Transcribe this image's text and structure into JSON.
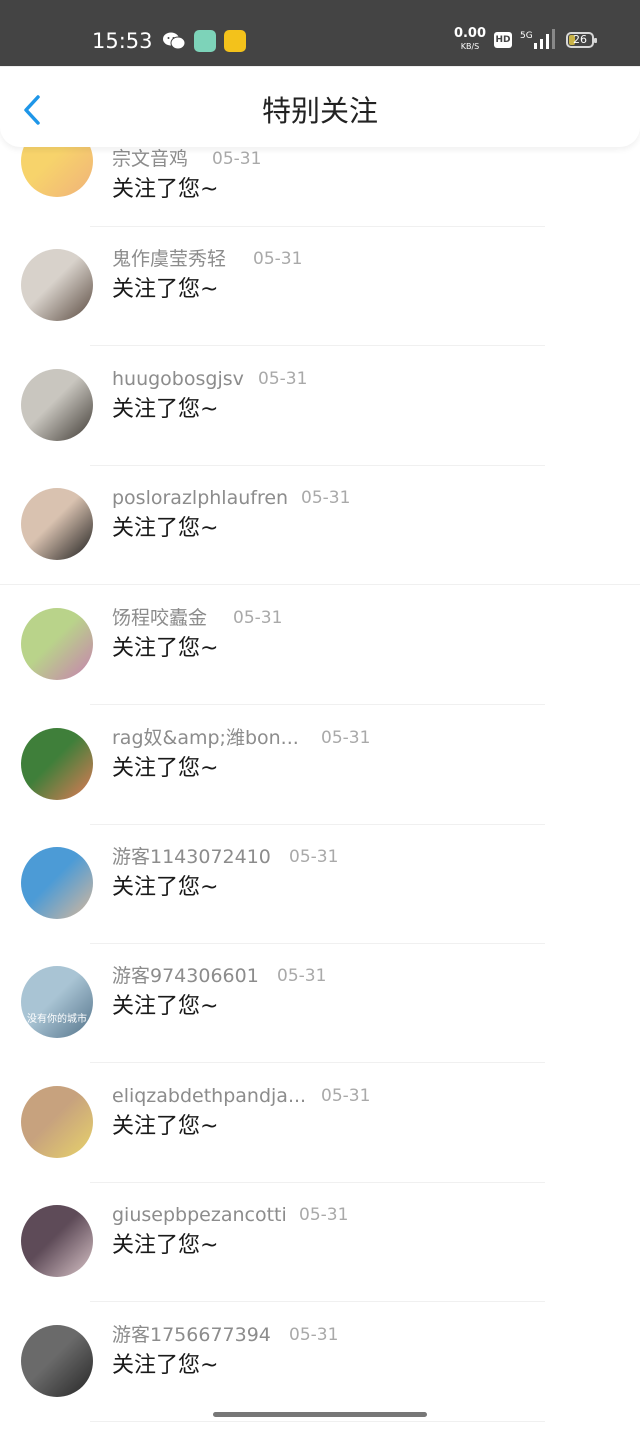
{
  "status_bar": {
    "time": "15:53",
    "net_speed": "0.00",
    "net_unit": "KB/S",
    "hd": "HD",
    "signal": "5G",
    "battery": "26"
  },
  "header": {
    "title": "特别关注",
    "back_icon": "chevron-left-icon"
  },
  "items": [
    {
      "name": "宗文音鸡",
      "date": "05-31",
      "message": "关注了您~",
      "avatar_colors": [
        "#f7d36b",
        "#f0b27a"
      ]
    },
    {
      "name": "鬼作虞莹秀轻",
      "date": "05-31",
      "message": "关注了您~",
      "avatar_colors": [
        "#d8d2cb",
        "#5a4a40"
      ]
    },
    {
      "name": "huugobosgjsv",
      "date": "05-31",
      "message": "关注了您~",
      "avatar_colors": [
        "#c9c6bf",
        "#3f3a34"
      ]
    },
    {
      "name": "poslorazlphlaufren",
      "date": "05-31",
      "message": "关注了您~",
      "avatar_colors": [
        "#d9c2b0",
        "#1d1d1d"
      ]
    },
    {
      "name": "饧程咬蠹金",
      "date": "05-31",
      "message": "关注了您~",
      "avatar_colors": [
        "#b9d38a",
        "#c77fb0"
      ]
    },
    {
      "name": "rag奴&amp;潍bon...",
      "date": "05-31",
      "message": "关注了您~",
      "avatar_colors": [
        "#3f7f3a",
        "#e37b57"
      ]
    },
    {
      "name": "游客1143072410",
      "date": "05-31",
      "message": "关注了您~",
      "avatar_colors": [
        "#4c9bd6",
        "#d9b89a"
      ]
    },
    {
      "name": "游客974306601",
      "date": "05-31",
      "message": "关注了您~",
      "avatar_colors": [
        "#a9c4d4",
        "#54738a"
      ],
      "avatar_caption": "没有你的城市"
    },
    {
      "name": "eliqzabdethpandja...",
      "date": "05-31",
      "message": "关注了您~",
      "avatar_colors": [
        "#c7a27e",
        "#e8d36a"
      ]
    },
    {
      "name": "giusepbpezancotti",
      "date": "05-31",
      "message": "关注了您~",
      "avatar_colors": [
        "#5e4b58",
        "#d9c4c8"
      ]
    },
    {
      "name": "游客1756677394",
      "date": "05-31",
      "message": "关注了您~",
      "avatar_colors": [
        "#6a6a6a",
        "#262626"
      ]
    }
  ]
}
